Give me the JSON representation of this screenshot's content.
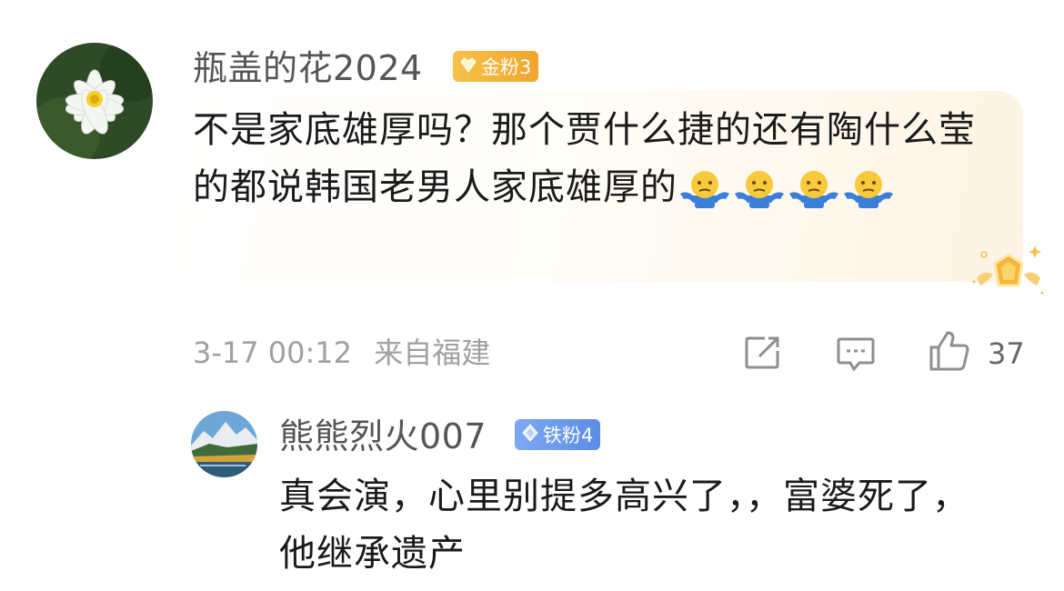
{
  "comment": {
    "username": "瓶盖的花2024",
    "badge": {
      "label": "金粉3",
      "color": "#f2b02f",
      "icon": "crown-gem-icon"
    },
    "text": "不是家底雄厚吗？那个贾什么捷的还有陶什么莹的都说韩国老男人家底雄厚的",
    "emoji": {
      "name": "shrug-emoji",
      "count": 4
    },
    "time": "3-17 00:12",
    "location": "来自福建",
    "like_count": "37",
    "actions": [
      "share-icon",
      "comment-icon",
      "like-icon"
    ]
  },
  "reply": {
    "username": "熊熊烈火007",
    "badge": {
      "label": "铁粉4",
      "color": "#6a97ea",
      "icon": "diamond-icon"
    },
    "text": "真会演，心里别提多高兴了，，富婆死了，他继承遗产"
  },
  "colors": {
    "meta_gray": "#a0a0a0",
    "text": "#1a1a1a",
    "username": "#555555"
  }
}
